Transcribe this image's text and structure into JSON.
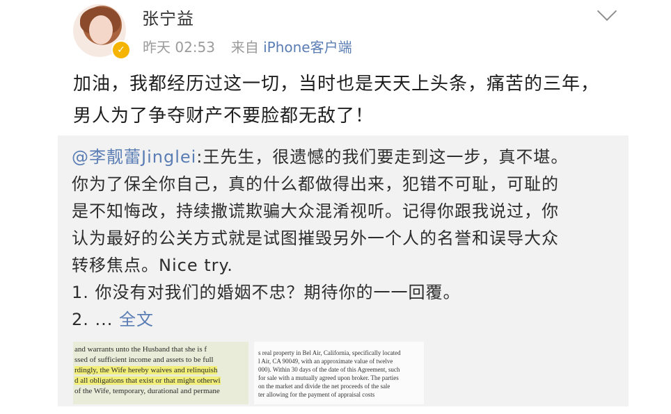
{
  "post": {
    "user_name": "张宁益",
    "time": "昨天 02:53",
    "source_prefix": "来自",
    "source": "iPhone客户端",
    "text": "加油，我都经历过这一切，当时也是天天上头条，痛苦的三年，男人为了争夺财产不要脸都无敌了！"
  },
  "repost": {
    "mention": "@李靓蕾Jinglei",
    "line1": ":王先生，很遗憾的我们要走到这一步，真不堪。",
    "line2": "你为了保全你自己，真的什么都做得出来，犯错不可耻，可耻的",
    "line3": "是不知悔改，持续撒谎欺骗大众混淆视听。记得你跟我说过，你",
    "line4": "认为最好的公关方式就是试图摧毁另外一个人的名誉和误导大众",
    "line5": "转移焦点。Nice try.",
    "line6": "1. 你没有对我们的婚姻不忠？期待你的一一回覆。",
    "line7_prefix": "2. ... ",
    "full_text_link": "全文",
    "doc1_lines": [
      "and warrants unto the Husband that she is f",
      "ssed of sufficient income and assets to be full",
      "rdingly, the Wife hereby waives and relinquish",
      "d all obligations that exist or that might otherwi",
      "of the Wife, temporary, durational and permane"
    ],
    "doc2_lines": [
      "s real property in Bel Air, California, specifically located",
      "l Air, CA 90049, with an approximate value of twelve",
      "000). Within 30 days of the date of this Agreement, such",
      "for sale with a mutually agreed upon broker. The parties",
      "on the market and divide the net proceeds of the sale",
      "ter allowing for the payment of appraisal costs"
    ]
  }
}
